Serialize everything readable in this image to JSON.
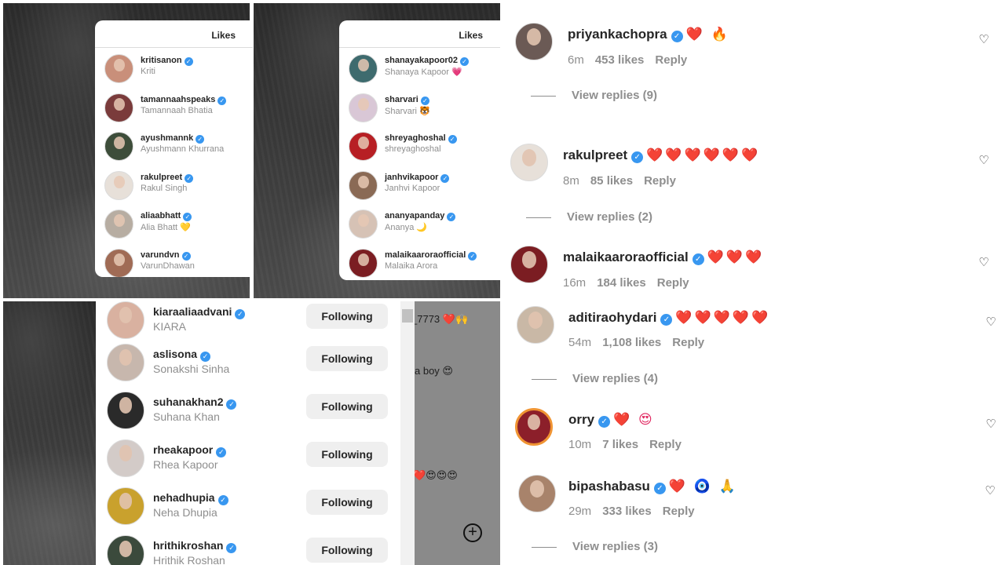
{
  "likes_panel_1": {
    "title": "Likes",
    "rows": [
      {
        "username": "kritisanon",
        "name": "Kriti",
        "avatar_color": "#c98f7a"
      },
      {
        "username": "tamannaahspeaks",
        "name": "Tamannaah Bhatia",
        "avatar_color": "#7a3b3b"
      },
      {
        "username": "ayushmannk",
        "name": "Ayushmann Khurrana",
        "avatar_color": "#3d4d3a"
      },
      {
        "username": "rakulpreet",
        "name": "Rakul Singh",
        "avatar_color": "#e7e0d9"
      },
      {
        "username": "aliaabhatt",
        "name": "Alia Bhatt 💛",
        "avatar_color": "#b7ada2"
      },
      {
        "username": "varundvn",
        "name": "VarunDhawan",
        "avatar_color": "#a06b55"
      }
    ]
  },
  "likes_panel_2": {
    "title": "Likes",
    "rows": [
      {
        "username": "shanayakapoor02",
        "name": "Shanaya Kapoor 💗",
        "avatar_color": "#3e6b6e"
      },
      {
        "username": "sharvari",
        "name": "Sharvari 🐯",
        "avatar_color": "#d9c7d6"
      },
      {
        "username": "shreyaghoshal",
        "name": "shreyaghoshal",
        "avatar_color": "#b71f24"
      },
      {
        "username": "janhvikapoor",
        "name": "Janhvi Kapoor",
        "avatar_color": "#8a6a55"
      },
      {
        "username": "ananyapanday",
        "name": "Ananya 🌙",
        "avatar_color": "#d6c2b5"
      },
      {
        "username": "malaikaaroraofficial",
        "name": "Malaika Arora",
        "avatar_color": "#7b1d22"
      }
    ]
  },
  "following_list": {
    "button_label": "Following",
    "rows": [
      {
        "username": "kiaraaliaadvani",
        "name": "KIARA",
        "avatar_color": "#d9b1a0"
      },
      {
        "username": "aslisona",
        "name": "Sonakshi Sinha",
        "avatar_color": "#c7b7ad"
      },
      {
        "username": "suhanakhan2",
        "name": "Suhana Khan",
        "avatar_color": "#2a2a2a"
      },
      {
        "username": "rheakapoor",
        "name": "Rhea Kapoor",
        "avatar_color": "#d3cbc8"
      },
      {
        "username": "nehadhupia",
        "name": "Neha Dhupia",
        "avatar_color": "#c9a12d"
      },
      {
        "username": "hrithikroshan",
        "name": "Hrithik Roshan",
        "avatar_color": "#3b4a3c"
      }
    ]
  },
  "background_fragments": {
    "frag_1": "_7773 ❤️🙌",
    "frag_2": "a boy 😍",
    "frag_3": "❤️😍😍😍"
  },
  "comments": [
    {
      "username": "priyankachopra",
      "text": "❤️ 🔥",
      "time": "6m",
      "likes": "453 likes",
      "reply": "Reply",
      "view_replies": "View replies (9)",
      "avatar_color": "#6b5a55"
    },
    {
      "username": "rakulpreet",
      "text": "❤️❤️❤️❤️❤️❤️",
      "time": "8m",
      "likes": "85 likes",
      "reply": "Reply",
      "view_replies": "View replies (2)",
      "avatar_color": "#e7e0d9"
    },
    {
      "username": "malaikaaroraofficial",
      "text": "❤️❤️❤️",
      "time": "16m",
      "likes": "184 likes",
      "reply": "Reply",
      "view_replies": "",
      "avatar_color": "#7b1d22"
    },
    {
      "username": "aditiraohydari",
      "text": "❤️❤️❤️❤️❤️",
      "time": "54m",
      "likes": "1,108 likes",
      "reply": "Reply",
      "view_replies": "View replies (4)",
      "avatar_color": "#c9b8a6"
    },
    {
      "username": "orry",
      "text": "❤️ 😍",
      "time": "10m",
      "likes": "7 likes",
      "reply": "Reply",
      "view_replies": "",
      "avatar_color": "#8c1f2a"
    },
    {
      "username": "bipashabasu",
      "text": "❤️ 🧿 🙏",
      "time": "29m",
      "likes": "333 likes",
      "reply": "Reply",
      "view_replies": "View replies (3)",
      "avatar_color": "#a8836b"
    }
  ],
  "icons": {
    "heart": "heart-outline-icon",
    "verified": "verified-badge-icon",
    "add": "add-circle-icon"
  }
}
